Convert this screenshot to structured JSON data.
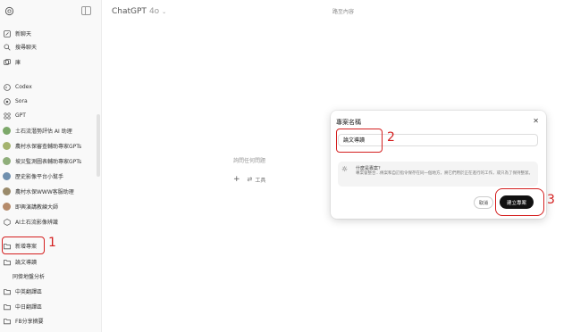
{
  "sidebar": {
    "items": [
      {
        "label": "新聊天",
        "icon": "pencil-icon"
      },
      {
        "label": "搜尋聊天",
        "icon": "search-icon"
      },
      {
        "label": "庫",
        "icon": "library-icon"
      },
      {
        "label": "Codex",
        "icon": "codex-icon"
      },
      {
        "label": "Sora",
        "icon": "sora-icon"
      },
      {
        "label": "GPT",
        "icon": "grid-icon"
      },
      {
        "label": "土石流潛勢評估 AI 助理",
        "icon": "gpt-avatar-icon"
      },
      {
        "label": "農村水保審查輔助專家GPTs",
        "icon": "gpt-avatar-icon"
      },
      {
        "label": "坡災監測圖表輔助專家GPTs",
        "icon": "gpt-avatar-icon"
      },
      {
        "label": "歷史影像平台小幫手",
        "icon": "gpt-avatar-icon"
      },
      {
        "label": "農村水保WWW客服助理",
        "icon": "gpt-avatar-icon"
      },
      {
        "label": "即興演講教練大師",
        "icon": "gpt-avatar-icon"
      },
      {
        "label": "AI土石流影像辨識",
        "icon": "gpt-avatar-icon"
      },
      {
        "label": "新增專案",
        "icon": "folder-plus-icon"
      },
      {
        "label": "論文導讀",
        "icon": "folder-icon"
      },
      {
        "label": "同儕地盤分析",
        "icon": ""
      },
      {
        "label": "中英翻譯區",
        "icon": "folder-icon"
      },
      {
        "label": "中日翻譯區",
        "icon": "folder-icon"
      },
      {
        "label": "FB分享摘要",
        "icon": "folder-icon"
      }
    ]
  },
  "header": {
    "model_name": "ChatGPT",
    "model_version": "4o",
    "path_label": "路至內容"
  },
  "main": {
    "placeholder": "詢問任何問題",
    "tools_label": "工具"
  },
  "modal": {
    "title": "專案名稱",
    "input_value": "論文導讀",
    "tip_title": "什麼是專案？",
    "tip_body": "專案會整合…條案和自訂指令保存在同一個地方，將它們用於正在進行的工作，或只為了保持整潔。",
    "cancel_label": "取消",
    "create_label": "建立專案"
  },
  "annotations": {
    "step1": "1",
    "step2": "2",
    "step3": "3"
  },
  "colors": {
    "annotation": "#d41f1f",
    "primary_button": "#111111"
  }
}
